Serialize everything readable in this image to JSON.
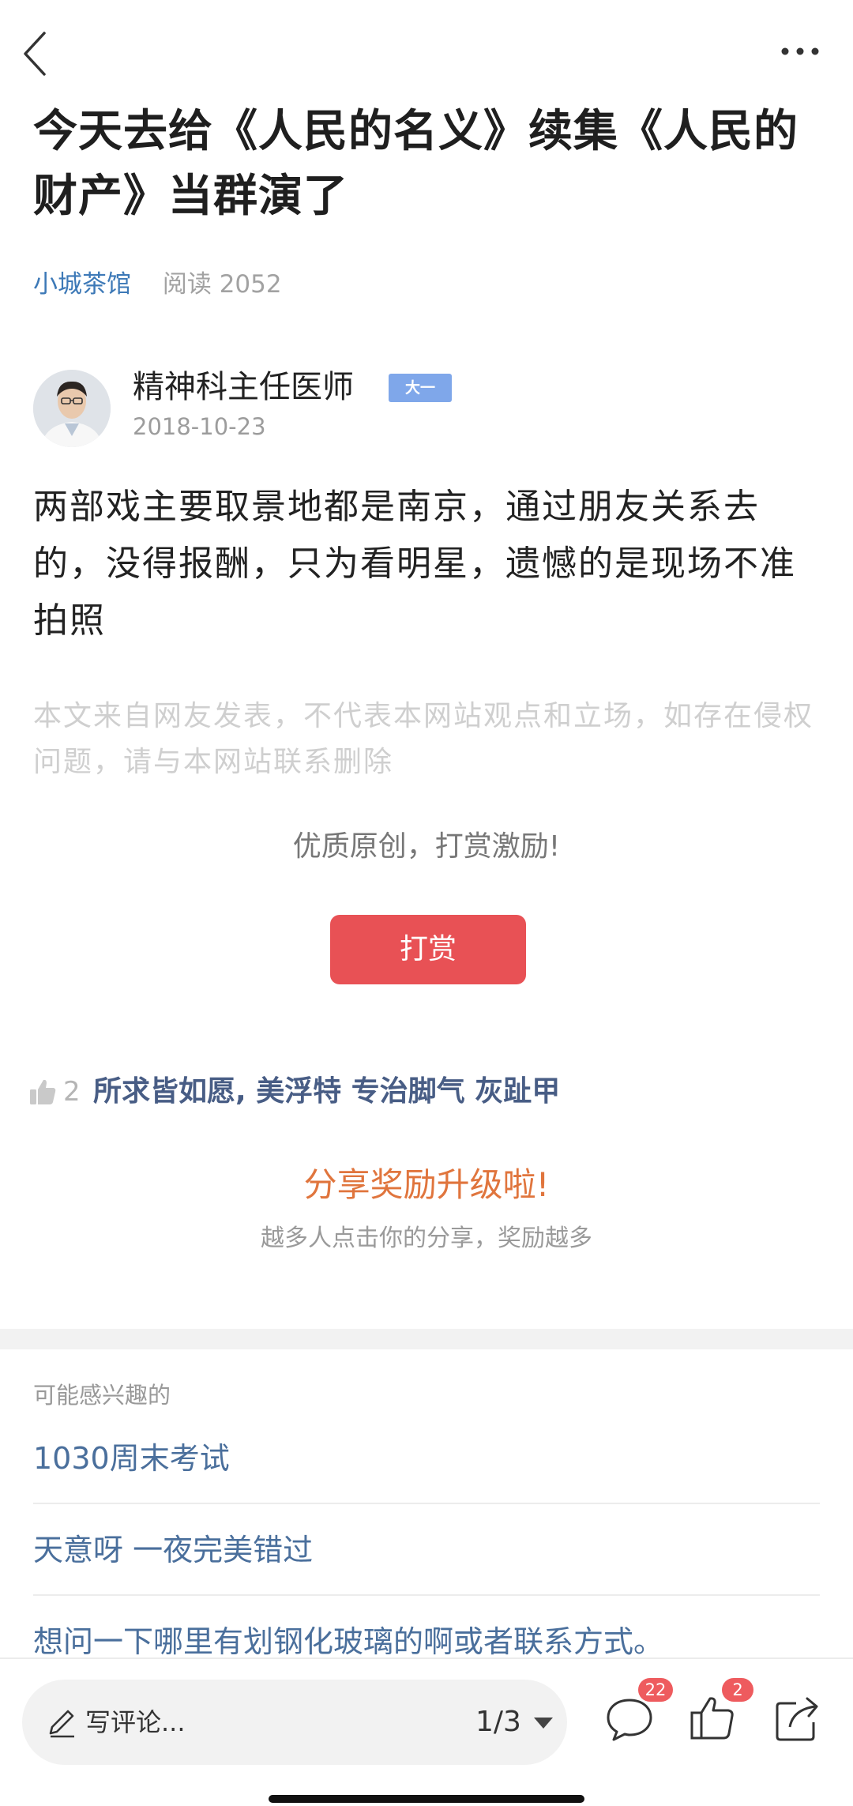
{
  "nav": {
    "back_icon": "chevron-left-icon",
    "more_icon": "ellipsis-icon"
  },
  "article": {
    "title": "今天去给《人民的名义》续集《人民的财产》当群演了",
    "channel": "小城茶馆",
    "reads": "阅读 2052",
    "author": {
      "name": "精神科主任医师",
      "badge": "大一",
      "date": "2018-10-23"
    },
    "body": "两部戏主要取景地都是南京，通过朋友关系去的，没得报酬，只为看明星，遗憾的是现场不准拍照",
    "disclaimer": "本文来自网友发表，不代表本网站观点和立场，如存在侵权问题，请与本网站联系删除"
  },
  "reward": {
    "prompt": "优质原创，打赏激励!",
    "button_label": "打赏"
  },
  "likes": {
    "count": "2",
    "likers": "所求皆如愿, 美浮特 专治脚气 灰趾甲"
  },
  "share": {
    "title": "分享奖励升级啦!",
    "subtitle": "越多人点击你的分享，奖励越多"
  },
  "related": {
    "heading": "可能感兴趣的",
    "items": [
      "1030周末考试",
      "天意呀 一夜完美错过",
      "想问一下哪里有划钢化玻璃的啊或者联系方式。"
    ]
  },
  "bottom_bar": {
    "comment_placeholder": "写评论...",
    "page_indicator": "1/3",
    "comment_count": "22",
    "like_count": "2"
  },
  "colors": {
    "link_blue": "#3d79b7",
    "reward_red": "#e85155",
    "share_orange": "#e0753d",
    "badge_blue": "#7fa7ea"
  }
}
